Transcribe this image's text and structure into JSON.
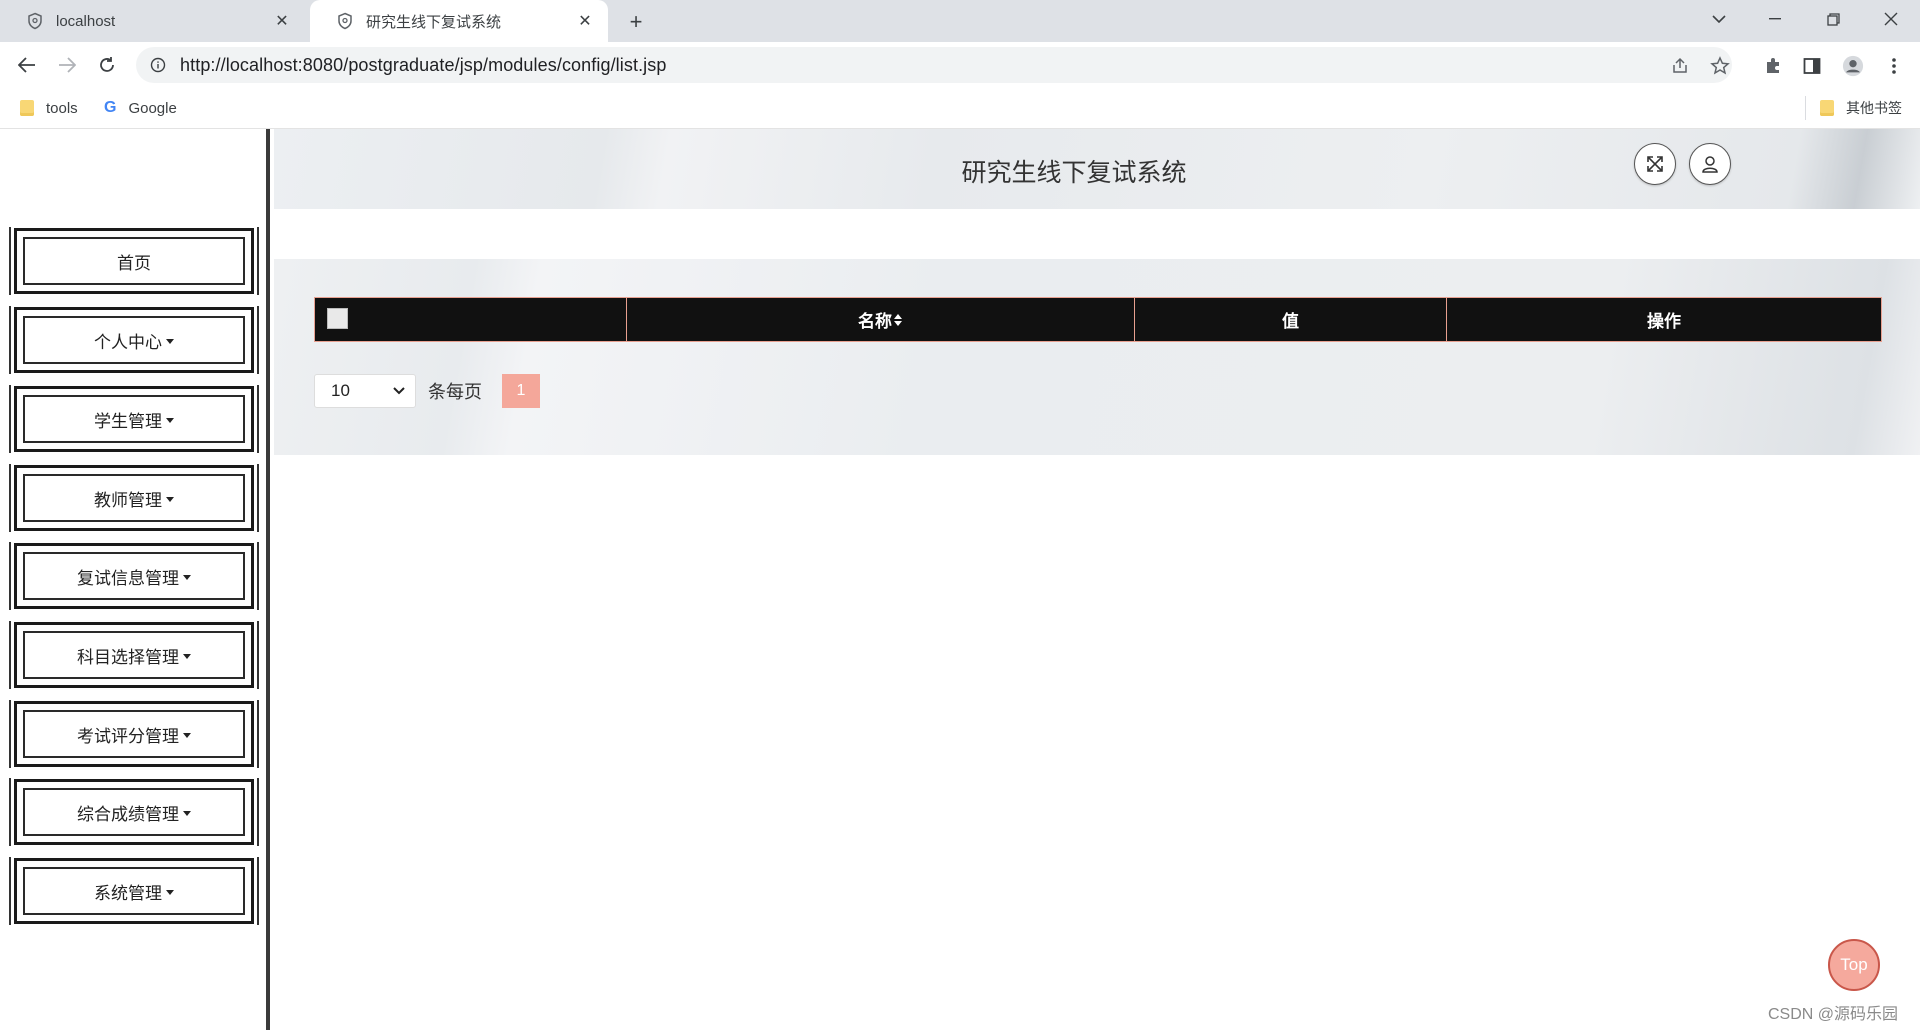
{
  "browser": {
    "tabs": [
      {
        "title": "localhost"
      },
      {
        "title": "研究生线下复试系统"
      }
    ],
    "url": "http://localhost:8080/postgraduate/jsp/modules/config/list.jsp",
    "bookmarks": [
      {
        "label": "tools"
      },
      {
        "label": "Google"
      },
      {
        "label": "其他书签"
      }
    ]
  },
  "header": {
    "title": "研究生线下复试系统"
  },
  "sidebar": {
    "items": [
      {
        "label": "首页",
        "dropdown": false
      },
      {
        "label": "个人中心",
        "dropdown": true
      },
      {
        "label": "学生管理",
        "dropdown": true
      },
      {
        "label": "教师管理",
        "dropdown": true
      },
      {
        "label": "复试信息管理",
        "dropdown": true
      },
      {
        "label": "科目选择管理",
        "dropdown": true
      },
      {
        "label": "考试评分管理",
        "dropdown": true
      },
      {
        "label": "综合成绩管理",
        "dropdown": true
      },
      {
        "label": "系统管理",
        "dropdown": true
      }
    ]
  },
  "table": {
    "columns": [
      "名称",
      "值",
      "操作"
    ]
  },
  "pagination": {
    "page_size": "10",
    "per_page_label": "条每页",
    "current_page": "1"
  },
  "top_button": "Top",
  "watermark": "CSDN @源码乐园",
  "colors": {
    "accent": "#f4a79a",
    "table_header_bg": "#111111",
    "table_border": "#e8a090"
  }
}
